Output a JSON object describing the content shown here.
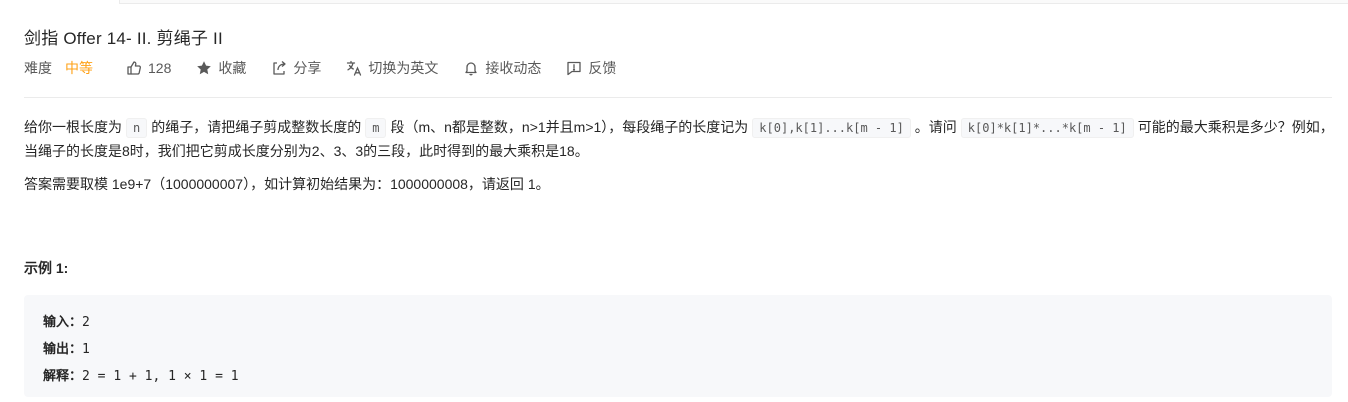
{
  "title": "剑指 Offer 14- II. 剪绳子 II",
  "meta": {
    "difficulty_label": "难度",
    "difficulty": "中等",
    "likes": "128",
    "favorite": "收藏",
    "share": "分享",
    "switch_lang": "切换为英文",
    "notify": "接收动态",
    "feedback": "反馈"
  },
  "colors": {
    "difficulty_medium": "#ffa116",
    "code_bg": "#f7f8fa"
  },
  "description": {
    "p1_a": "给你一根长度为",
    "p1_code_n": "n",
    "p1_b": "的绳子，请把绳子剪成整数长度的",
    "p1_code_m": "m",
    "p1_c": "段（m、n都是整数，n>1并且m>1），每段绳子的长度记为",
    "p1_code_k": "k[0],k[1]...k[m - 1]",
    "p1_d": "。请问",
    "p1_code_prod": "k[0]*k[1]*...*k[m - 1]",
    "p1_e": "可能的最大乘积是多少？例如，当绳子的长度是8时，我们把它剪成长度分别为2、3、3的三段，此时得到的最大乘积是18。",
    "p2": "答案需要取模 1e9+7（1000000007），如计算初始结果为：1000000008，请返回 1。"
  },
  "example": {
    "title": "示例 1:",
    "input_label": "输入：",
    "input_value": "2",
    "output_label": "输出：",
    "output_value": "1",
    "explain_label": "解释：",
    "explain_value": "2 = 1 + 1, 1 × 1 = 1"
  }
}
